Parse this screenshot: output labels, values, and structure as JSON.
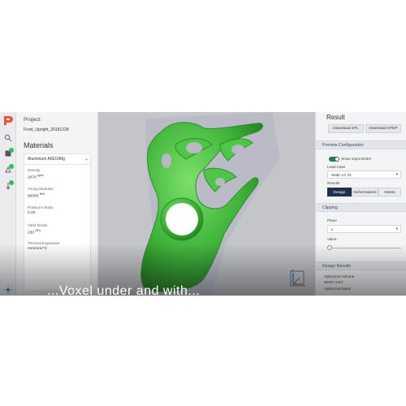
{
  "left_panel": {
    "project_label": "Project:",
    "project_name": "Front_Upright_20181228",
    "materials_title": "Materials",
    "material_selected": "Aluminium AlSi10Mg",
    "properties": [
      {
        "key": "Density",
        "value": "2670",
        "unit": "kg/m³"
      },
      {
        "key": "Young Modulus",
        "value": "60000",
        "unit": "MPa"
      },
      {
        "key": "Poisson's Ratio",
        "value": "0.33",
        "unit": ""
      },
      {
        "key": "Yield Stress",
        "value": "230",
        "unit": "MPa"
      },
      {
        "key": "Thermal Expansion",
        "value": "mm/mm/°C",
        "unit": ""
      }
    ]
  },
  "right_panel": {
    "result_title": "Result",
    "download_stl": "Download STL",
    "download_step": "Download STEP",
    "preview_section": "Preview Configuration",
    "show_input_model": "Show Input Model",
    "show_input_model_on": true,
    "load_case_label": "Load Case",
    "load_case_value": "Static LC #1",
    "results_label": "Results",
    "results_tabs": [
      "Design",
      "Deformations",
      "Stress"
    ],
    "results_active": "Design",
    "clipping_section": "Clipping",
    "plane_label": "Plane",
    "plane_value": "x",
    "value_label": "Value",
    "clip_value_fraction": 0.0,
    "design_results_section": "Design Results",
    "optimized_volume_label": "Optimized Volume",
    "optimized_volume_value": "86097 mm³",
    "optimized_mass_label": "Optimized Mass"
  },
  "viewport": {
    "model_color": "#3fb43a",
    "axis_x_label": "x",
    "axis_y_label": "y",
    "axis_z_label": "z"
  },
  "caption": "...Voxel under and with..."
}
